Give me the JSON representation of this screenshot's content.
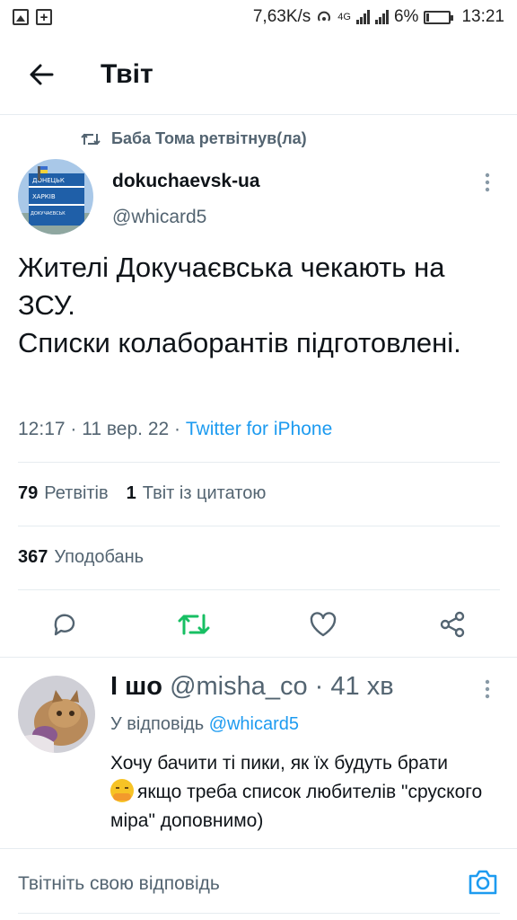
{
  "status_bar": {
    "speed": "7,63K/s",
    "network": "4G",
    "battery_percent": "6%",
    "time": "13:21"
  },
  "header": {
    "title": "Твіт"
  },
  "retweet_context": "Баба Тома ретвітнув(ла)",
  "tweet": {
    "author_name": "dokuchaevsk-ua",
    "author_handle": "@whicard5",
    "avatar_sign_lines": [
      "ДОНЕЦЬК",
      "ХАРКІВ",
      "ДОКУЧАЄВСЬК"
    ],
    "text": "Жителі Докучаєвська чекають на ЗСУ.\nСписки колаборантів підготовлені.",
    "time": "12:17",
    "separator": " · ",
    "date": "11 вер. 22",
    "source": "Twitter for iPhone",
    "stats": {
      "retweets_count": "79",
      "retweets_label": "Ретвітів",
      "quotes_count": "1",
      "quotes_label": "Твіт із цитатою",
      "likes_count": "367",
      "likes_label": "Уподобань"
    }
  },
  "actions": {
    "icons": [
      "reply-icon",
      "retweet-icon",
      "like-icon",
      "share-icon"
    ],
    "retweet_active_color": "#17bf63"
  },
  "reply": {
    "name": "І шо",
    "handle": "@misha_co",
    "separator": " · ",
    "time_ago": "41 хв",
    "replying_to_label": "У відповідь",
    "replying_to_handle": "@whicard5",
    "text_part1": "Хочу бачити ті пики, як їх будуть брати",
    "text_part2": "якщо треба список любителів \"сруского міра\" доповнимо)"
  },
  "compose": {
    "placeholder": "Твітніть свою відповідь"
  },
  "colors": {
    "accent": "#1d9bf0",
    "secondary_text": "#536471",
    "retweet_green": "#17bf63"
  }
}
